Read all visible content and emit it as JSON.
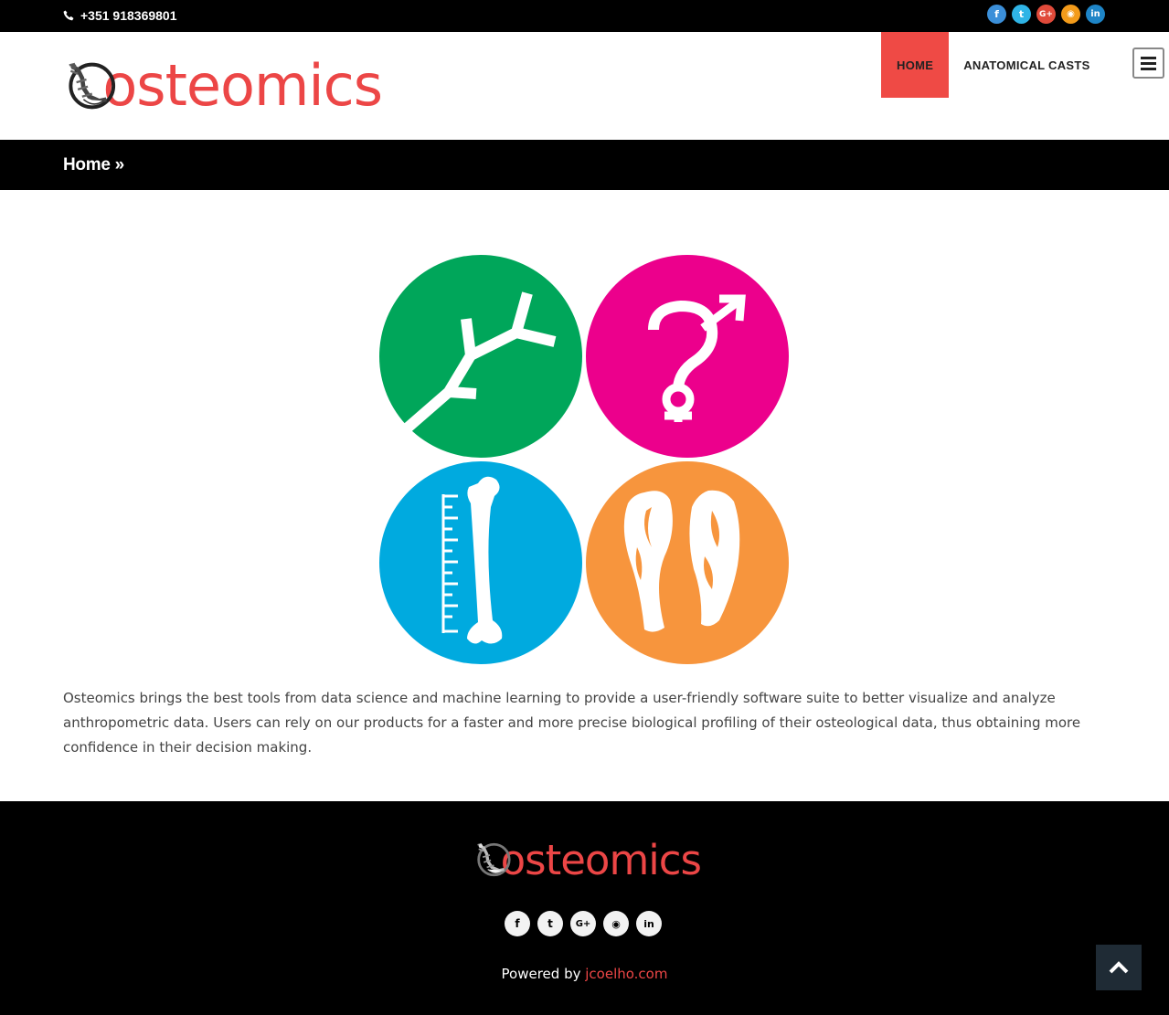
{
  "topbar": {
    "phone": "+351 918369801",
    "social": [
      {
        "name": "facebook-icon",
        "glyph": "f",
        "color": "#3b8fd9"
      },
      {
        "name": "twitter-icon",
        "glyph": "t",
        "color": "#2fb4e6"
      },
      {
        "name": "google-plus-icon",
        "glyph": "G+",
        "color": "#e04a3a"
      },
      {
        "name": "rss-icon",
        "glyph": "◉",
        "color": "#f39b1a"
      },
      {
        "name": "linkedin-icon",
        "glyph": "in",
        "color": "#1e85c7"
      }
    ]
  },
  "header": {
    "logo_text": "osteomics",
    "nav": [
      {
        "label": "HOME",
        "active": true
      },
      {
        "label": "ANATOMICAL CASTS",
        "active": false
      }
    ],
    "menu_icon": "hamburger-icon"
  },
  "breadcrumb": {
    "text": "Home »"
  },
  "main": {
    "icons": [
      {
        "name": "tree-icon",
        "color": "#00a65a"
      },
      {
        "name": "gender-question-icon",
        "color": "#ec008c"
      },
      {
        "name": "bone-ruler-icon",
        "color": "#00aadf"
      },
      {
        "name": "bone-section-icon",
        "color": "#f7953d"
      }
    ],
    "intro": "Osteomics brings the best tools from data science and machine learning to provide a user-friendly software suite to better visualize and analyze anthropometric data. Users can rely on our products for a faster and more precise biological profiling of their osteological data, thus obtaining more confidence in their decision making."
  },
  "footer": {
    "logo_text": "osteomics",
    "social": [
      {
        "name": "facebook-icon",
        "glyph": "f"
      },
      {
        "name": "twitter-icon",
        "glyph": "t"
      },
      {
        "name": "google-plus-icon",
        "glyph": "G+"
      },
      {
        "name": "rss-icon",
        "glyph": "◉"
      },
      {
        "name": "linkedin-icon",
        "glyph": "in"
      }
    ],
    "powered_prefix": "Powered by ",
    "powered_link": "jcoelho.com",
    "back_to_top_icon": "chevron-up-icon"
  },
  "colors": {
    "brand_red": "#ec4646",
    "nav_active": "#ef4a45",
    "footer_bg": "#000000"
  }
}
